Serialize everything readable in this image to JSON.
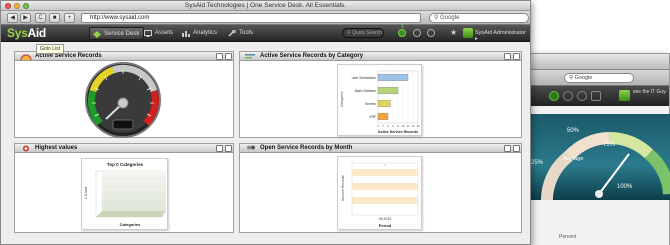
{
  "browser": {
    "title": "SysAid Technologies | One Service Desk. All Essentials.",
    "url": "http://www.sysaid.com",
    "search_placeholder": "Google",
    "nav_buttons": [
      "◀",
      "▶",
      "C",
      "■",
      "+"
    ]
  },
  "app": {
    "logo_a": "Sys",
    "logo_b": "Aid",
    "nav": [
      {
        "label": "Service Desk",
        "active": true
      },
      {
        "label": "Assets"
      },
      {
        "label": "Analytics"
      },
      {
        "label": "Tools"
      }
    ],
    "quick_search_placeholder": "Quick Search",
    "user": "SysAid Administrator",
    "badge": "1",
    "tooltip": "Goto List"
  },
  "panels": {
    "active_records": {
      "title": "Active Service Records"
    },
    "by_category": {
      "title": "Active Service Records by Category",
      "chart_data": {
        "type": "bar",
        "orientation": "horizontal",
        "categories": [
          "User Workstation",
          "Basic Software",
          "Servers",
          "ERP"
        ],
        "values": [
          12,
          8,
          5,
          4
        ],
        "xlim": [
          0,
          16
        ],
        "xlabel": "Active Service Records",
        "ylabel": "Categories",
        "ticks": [
          "0",
          "2",
          "4",
          "6",
          "8",
          "10",
          "12",
          "14",
          "16"
        ],
        "colors": [
          "#9cc4e8",
          "#b5d47a",
          "#e4d25a",
          "#f2a33a"
        ]
      }
    },
    "highest_values": {
      "title": "Highest values",
      "chart_title": "Top 0 Categories",
      "xlabel": "Categories",
      "ylabel": "# Count"
    },
    "by_month": {
      "title": "Open Service Records by Month",
      "chart_data": {
        "type": "line",
        "x": [
          "05 2013"
        ],
        "values": [
          1
        ],
        "xlabel": "Period",
        "ylabel": "Service Records"
      }
    }
  },
  "back_window": {
    "search_placeholder": "Google",
    "user_label": "see the IT Guy",
    "gauge_labels": [
      "50%",
      "Average",
      "75%",
      "25%",
      "100%"
    ],
    "bottom_text": "Percent"
  }
}
